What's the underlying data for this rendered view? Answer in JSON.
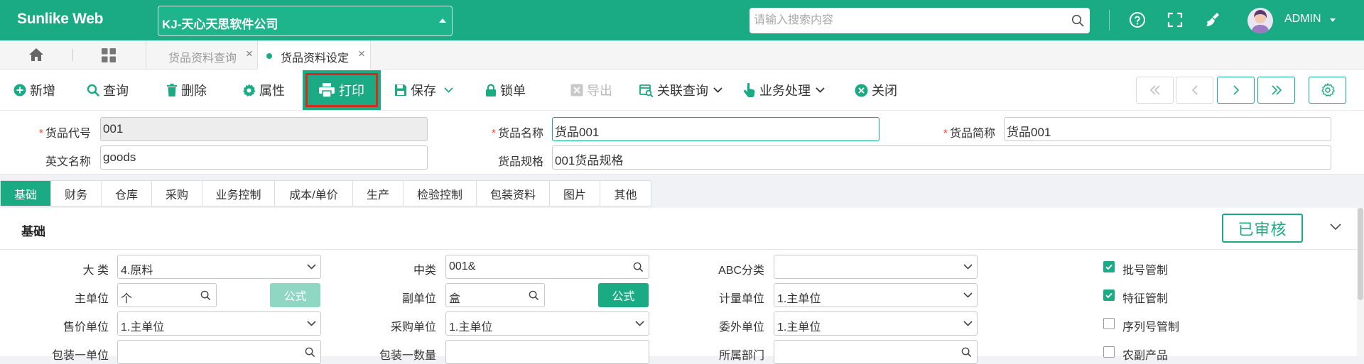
{
  "header": {
    "logo": "Sunlike Web",
    "company": "KJ-天心天思软件公司",
    "search_placeholder": "请输入搜索内容",
    "user": "ADMIN"
  },
  "page_tabs": [
    {
      "label": "货品资料查询",
      "active": false
    },
    {
      "label": "货品资料设定",
      "active": true
    }
  ],
  "toolbar": {
    "add": "新增",
    "query": "查询",
    "delete": "删除",
    "properties": "属性",
    "print": "打印",
    "save": "保存",
    "lock": "锁单",
    "export": "导出",
    "linked_query": "关联查询",
    "business": "业务处理",
    "close": "关闭"
  },
  "colors": {
    "brand": "#1aaa84",
    "highlight": "#d9291c"
  },
  "top_fields": {
    "item_code": {
      "label": "货品代号",
      "value": "001",
      "required": true
    },
    "item_name": {
      "label": "货品名称",
      "value": "货品001",
      "required": true
    },
    "item_short": {
      "label": "货品简称",
      "value": "货品001",
      "required": true
    },
    "english_name": {
      "label": "英文名称",
      "value": "goods"
    },
    "spec": {
      "label": "货品规格",
      "value": "001货品规格"
    }
  },
  "section_tabs": [
    "基础",
    "财务",
    "仓库",
    "采购",
    "业务控制",
    "成本/单价",
    "生产",
    "检验控制",
    "包装资料",
    "图片",
    "其他"
  ],
  "section": {
    "title": "基础",
    "status": "已审核"
  },
  "form": {
    "category_major": {
      "label": "大 类",
      "value": "4.原料"
    },
    "category_mid": {
      "label": "中类",
      "value": "001&"
    },
    "abc": {
      "label": "ABC分类",
      "value": ""
    },
    "main_unit": {
      "label": "主单位",
      "value": "个"
    },
    "formula1": "公式",
    "sub_unit": {
      "label": "副单位",
      "value": "盒"
    },
    "formula2": "公式",
    "measure_unit": {
      "label": "计量单位",
      "value": "1.主单位"
    },
    "sale_unit": {
      "label": "售价单位",
      "value": "1.主单位"
    },
    "purchase_unit": {
      "label": "采购单位",
      "value": "1.主单位"
    },
    "outsource_unit": {
      "label": "委外单位",
      "value": "1.主单位"
    },
    "pack_unit": {
      "label": "包装一单位",
      "value": ""
    },
    "pack_qty": {
      "label": "包装一数量",
      "value": ""
    },
    "department": {
      "label": "所属部门",
      "value": ""
    },
    "checks": [
      {
        "label": "批号管制",
        "checked": true
      },
      {
        "label": "特征管制",
        "checked": true
      },
      {
        "label": "序列号管制",
        "checked": false
      },
      {
        "label": "农副产品",
        "checked": false
      }
    ]
  }
}
